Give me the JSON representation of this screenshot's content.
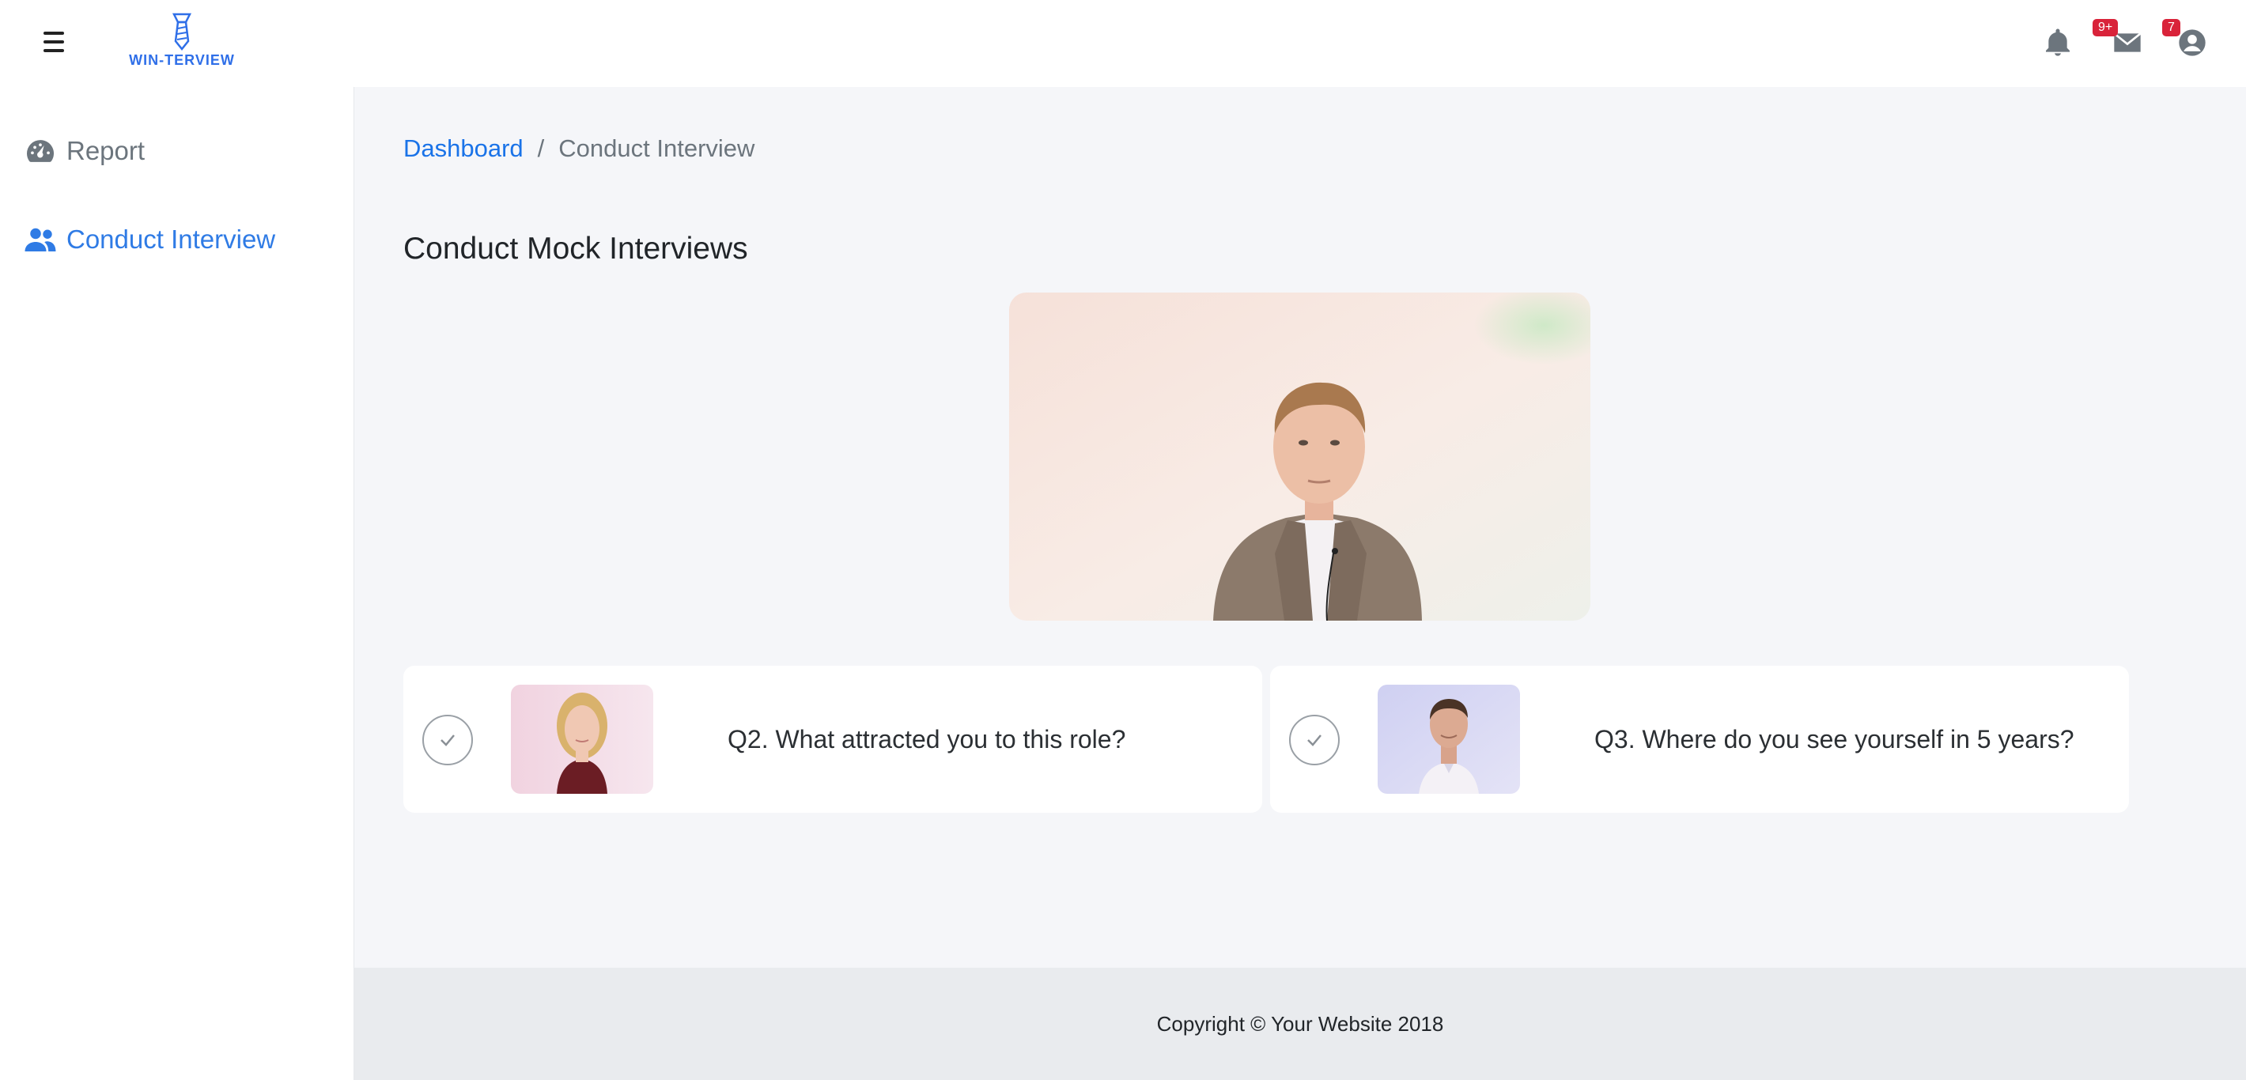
{
  "app": {
    "brand": "WIN-TERVIEW",
    "accent_color": "#2f7be5",
    "badge_color": "#d9233a"
  },
  "topbar": {
    "menu_icon": "hamburger-icon",
    "icons": [
      {
        "name": "bell-icon",
        "badge": ""
      },
      {
        "name": "envelope-icon",
        "badge": "9+"
      },
      {
        "name": "user-circle-icon",
        "badge": "7"
      }
    ]
  },
  "sidebar": {
    "items": [
      {
        "label": "Report",
        "icon": "gauge-icon",
        "active": false
      },
      {
        "label": "Conduct Interview",
        "icon": "users-icon",
        "active": true
      }
    ]
  },
  "breadcrumb": {
    "link": "Dashboard",
    "separator": "/",
    "current": "Conduct Interview"
  },
  "main": {
    "title": "Conduct Mock Interviews",
    "questions": [
      {
        "text": "Q2. What attracted you to this role?",
        "thumbnail": "woman-interviewer-thumbnail"
      },
      {
        "text": "Q3. Where do you see yourself in 5 years?",
        "thumbnail": "man-interviewer-thumbnail"
      }
    ]
  },
  "footer": {
    "copyright": "Copyright © Your Website 2018"
  }
}
